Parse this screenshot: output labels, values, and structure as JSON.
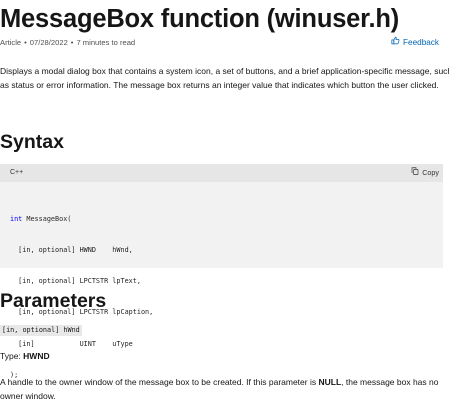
{
  "article": {
    "title": "MessageBox function (winuser.h)",
    "meta": {
      "type": "Article",
      "date": "07/28/2022",
      "read_time": "7 minutes to read"
    },
    "feedback_label": "Feedback",
    "description": "Displays a modal dialog box that contains a system icon, a set of buttons, and a brief application-specific message, such as status or error information. The message box returns an integer value that indicates which button the user clicked."
  },
  "syntax": {
    "heading": "Syntax",
    "language": "C++",
    "copy_label": "Copy",
    "code": {
      "line1_keyword": "int",
      "line1_rest": " MessageBox(",
      "line2": "  [in, optional] HWND    hWnd,",
      "line3": "  [in, optional] LPCTSTR lpText,",
      "line4": "  [in, optional] LPCTSTR lpCaption,",
      "line5": "  [in]           UINT    uType",
      "line6": ");"
    }
  },
  "parameters": {
    "heading": "Parameters",
    "items": [
      {
        "name": "[in, optional] hWnd",
        "type_label": "Type: ",
        "type_value": "HWND",
        "desc_before": "A handle to the owner window of the message box to be created. If this parameter is ",
        "desc_bold": "NULL",
        "desc_after": ", the message box has no owner window."
      }
    ]
  },
  "colors": {
    "link": "#0065b3",
    "code_background": "#f2f2f2",
    "code_header_background": "#e6e6e6",
    "keyword": "#0000ff"
  },
  "icons": {
    "feedback": "feedback-thumbs-icon",
    "copy": "copy-icon"
  }
}
